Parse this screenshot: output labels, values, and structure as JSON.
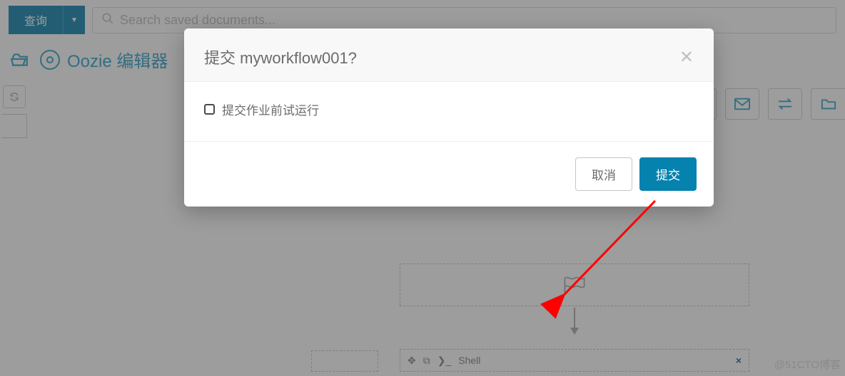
{
  "topbar": {
    "query_label": "查询",
    "search_placeholder": "Search saved documents..."
  },
  "subhead": {
    "title": "Oozie 编辑器"
  },
  "modal": {
    "title": "提交 myworkflow001?",
    "dryrun_label": "提交作业前试运行",
    "cancel_label": "取消",
    "submit_label": "提交"
  },
  "flow": {
    "shell_label": "Shell"
  },
  "watermark": "@51CTO博客"
}
